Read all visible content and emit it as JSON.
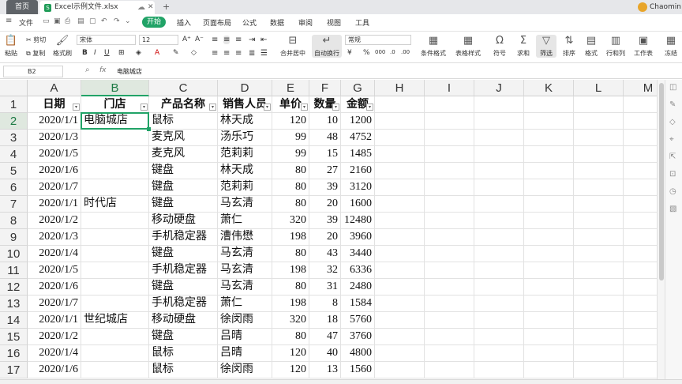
{
  "titlebar": {
    "home_tab": "首页",
    "file_tab": "Excel示例文件.xlsx",
    "user": "Chaomin"
  },
  "menu": {
    "file": "文件",
    "items": [
      "开始",
      "插入",
      "页面布局",
      "公式",
      "数据",
      "审阅",
      "视图",
      "工具"
    ]
  },
  "ribbon": {
    "paste": "粘贴",
    "cut": "剪切",
    "copy": "复制",
    "format_painter": "格式刷",
    "font_name": "宋体",
    "font_size": "12",
    "merge_center": "合并居中",
    "wrap_text": "自动换行",
    "number_format": "常规",
    "conditional_format": "条件格式",
    "table_style": "表格样式",
    "symbol": "符号",
    "sum": "求和",
    "filter": "筛选",
    "sort": "排序",
    "format": "格式",
    "rows_cols": "行和列",
    "worksheet": "工作表",
    "freeze": "冻结"
  },
  "formula": {
    "cell_ref": "B2",
    "fx": "fx",
    "content": "电脑城店"
  },
  "sheet": {
    "columns": [
      "A",
      "B",
      "C",
      "D",
      "E",
      "F",
      "G",
      "H",
      "I",
      "J",
      "K",
      "L",
      "M"
    ],
    "row_numbers": [
      "1",
      "2",
      "3",
      "4",
      "5",
      "6",
      "7",
      "8",
      "9",
      "10",
      "11",
      "12",
      "13",
      "14",
      "15",
      "16",
      "17"
    ],
    "headers": [
      "日期",
      "门店",
      "产品名称",
      "销售人员",
      "单价",
      "数量",
      "金额"
    ],
    "rows": [
      [
        "2020/1/1",
        "电脑城店",
        "鼠标",
        "林天成",
        "120",
        "10",
        "1200"
      ],
      [
        "2020/1/3",
        "",
        "麦克风",
        "汤乐巧",
        "99",
        "48",
        "4752"
      ],
      [
        "2020/1/5",
        "",
        "麦克风",
        "范莉莉",
        "99",
        "15",
        "1485"
      ],
      [
        "2020/1/6",
        "",
        "键盘",
        "林天成",
        "80",
        "27",
        "2160"
      ],
      [
        "2020/1/7",
        "",
        "键盘",
        "范莉莉",
        "80",
        "39",
        "3120"
      ],
      [
        "2020/1/1",
        "时代店",
        "键盘",
        "马玄清",
        "80",
        "20",
        "1600"
      ],
      [
        "2020/1/2",
        "",
        "移动硬盘",
        "萧仁",
        "320",
        "39",
        "12480"
      ],
      [
        "2020/1/3",
        "",
        "手机稳定器",
        "漕伟懋",
        "198",
        "20",
        "3960"
      ],
      [
        "2020/1/4",
        "",
        "键盘",
        "马玄清",
        "80",
        "43",
        "3440"
      ],
      [
        "2020/1/5",
        "",
        "手机稳定器",
        "马玄清",
        "198",
        "32",
        "6336"
      ],
      [
        "2020/1/6",
        "",
        "键盘",
        "马玄清",
        "80",
        "31",
        "2480"
      ],
      [
        "2020/1/7",
        "",
        "手机稳定器",
        "萧仁",
        "198",
        "8",
        "1584"
      ],
      [
        "2020/1/1",
        "世纪城店",
        "移动硬盘",
        "徐闵雨",
        "320",
        "18",
        "5760"
      ],
      [
        "2020/1/2",
        "",
        "键盘",
        "吕晴",
        "80",
        "47",
        "3760"
      ],
      [
        "2020/1/4",
        "",
        "鼠标",
        "吕晴",
        "120",
        "40",
        "4800"
      ],
      [
        "2020/1/6",
        "",
        "鼠标",
        "徐闵雨",
        "120",
        "13",
        "1560"
      ]
    ]
  },
  "colors": {
    "accent": "#21a367",
    "header_bg": "#f3f3f3",
    "selected_header_bg": "#dfe8df"
  }
}
